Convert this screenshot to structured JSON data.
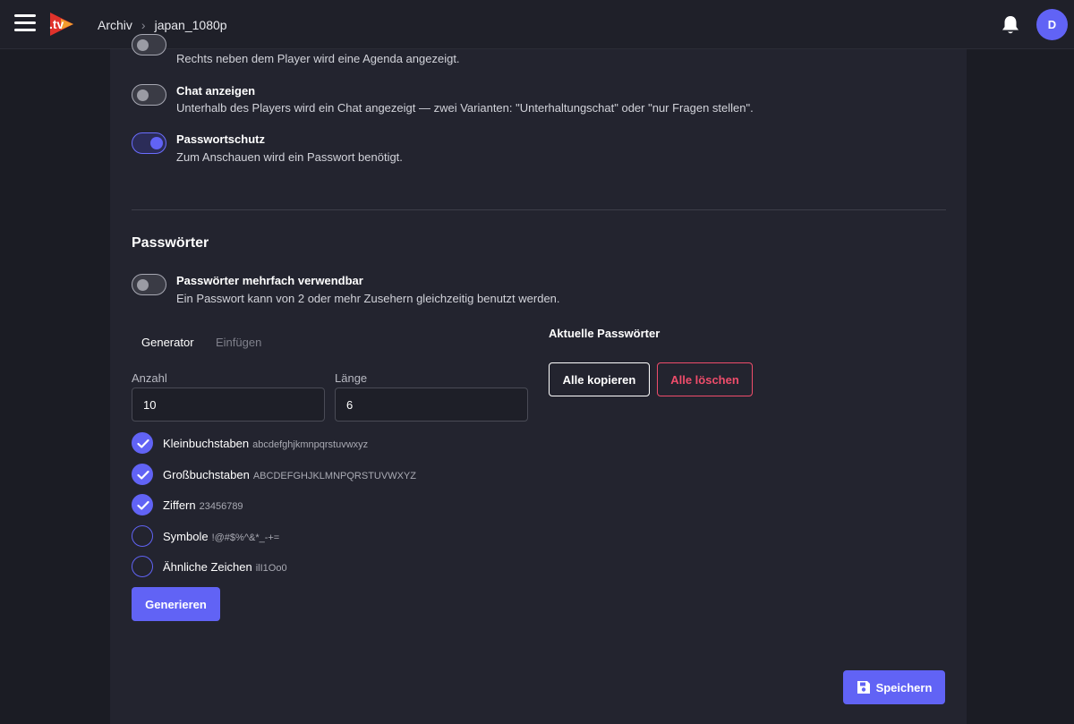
{
  "header": {
    "logo_text": ".tv",
    "breadcrumb": [
      "Archiv",
      "japan_1080p"
    ],
    "avatar_initial": "D"
  },
  "options": [
    {
      "title": "",
      "description": "Rechts neben dem Player wird eine Agenda angezeigt.",
      "enabled": false
    },
    {
      "title": "Chat anzeigen",
      "description": "Unterhalb des Players wird ein Chat angezeigt — zwei Varianten: \"Unterhaltungschat\" oder \"nur Fragen stellen\".",
      "enabled": false
    },
    {
      "title": "Passwortschutz",
      "description": "Zum Anschauen wird ein Passwort benötigt.",
      "enabled": true
    }
  ],
  "passwords": {
    "section_title": "Passwörter",
    "reuse_title": "Passwörter mehrfach verwendbar",
    "reuse_description": "Ein Passwort kann von 2 oder mehr Zusehern gleichzeitig benutzt werden.",
    "reuse_enabled": false,
    "tabs": [
      "Generator",
      "Einfügen"
    ],
    "active_tab": "Generator",
    "count_label": "Anzahl",
    "count_value": "10",
    "length_label": "Länge",
    "length_value": "6",
    "charsets": [
      {
        "label": "Kleinbuchstaben",
        "chars": "abcdefghjkmnpqrstuvwxyz",
        "checked": true
      },
      {
        "label": "Großbuchstaben",
        "chars": "ABCDEFGHJKLMNPQRSTUVWXYZ",
        "checked": true
      },
      {
        "label": "Ziffern",
        "chars": "23456789",
        "checked": true
      },
      {
        "label": "Symbole",
        "chars": "!@#$%^&*_-+=",
        "checked": false
      },
      {
        "label": "Ähnliche Zeichen",
        "chars": "ilI1Oo0",
        "checked": false
      }
    ],
    "generate_label": "Generieren",
    "current_title": "Aktuelle Passwörter",
    "copy_all_label": "Alle kopieren",
    "delete_all_label": "Alle löschen"
  },
  "save_label": "Speichern",
  "colors": {
    "accent": "#6163f5",
    "danger": "#ef4d6b",
    "background": "#1b1c24",
    "panel": "#23242f"
  }
}
